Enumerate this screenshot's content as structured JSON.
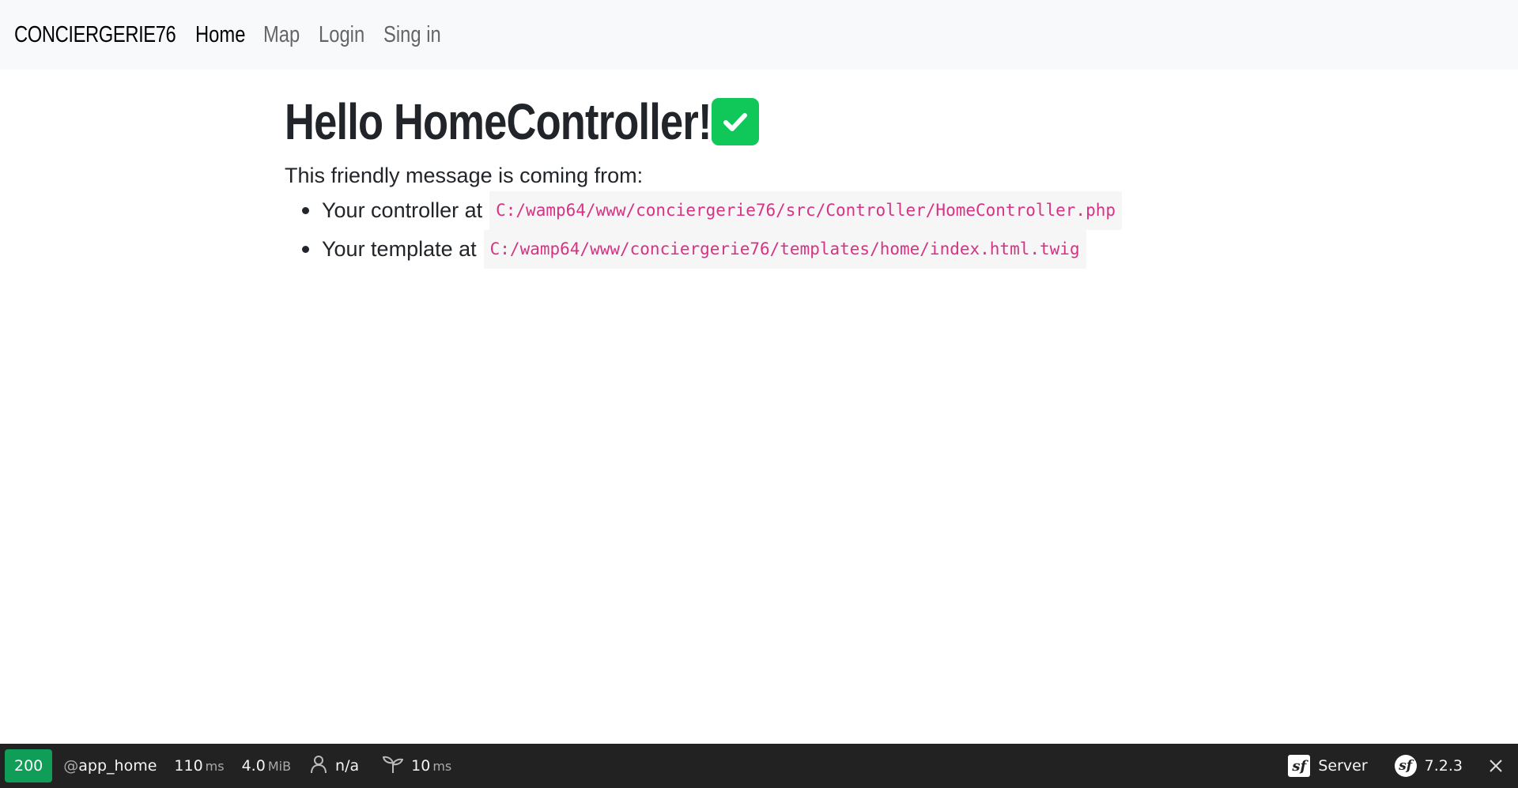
{
  "navbar": {
    "brand": "CONCIERGERIE76",
    "links": [
      {
        "label": "Home",
        "active": true
      },
      {
        "label": "Map",
        "active": false
      },
      {
        "label": "Login",
        "active": false
      },
      {
        "label": "Sing in",
        "active": false
      }
    ]
  },
  "main": {
    "title": "Hello HomeController!",
    "title_icon": "check-mark-button-icon",
    "intro": "This friendly message is coming from:",
    "items": [
      {
        "prefix": "Your controller at",
        "path": "C:/wamp64/www/conciergerie76/src/Controller/HomeController.php"
      },
      {
        "prefix": "Your template at",
        "path": "C:/wamp64/www/conciergerie76/templates/home/index.html.twig"
      }
    ]
  },
  "toolbar": {
    "status_code": "200",
    "route_at": "@",
    "route_name": "app_home",
    "time_value": "110",
    "time_unit": "ms",
    "memory_value": "4.0",
    "memory_unit": "MiB",
    "user_value": "n/a",
    "twig_value": "10",
    "twig_unit": "ms",
    "server_label": "Server",
    "version": "7.2.3",
    "colors": {
      "background": "#222222",
      "status_ok": "#0f9d58"
    }
  },
  "colors": {
    "navbar_bg": "#f8f9fa",
    "code_text": "#d63384",
    "check_green": "#10c85a"
  }
}
